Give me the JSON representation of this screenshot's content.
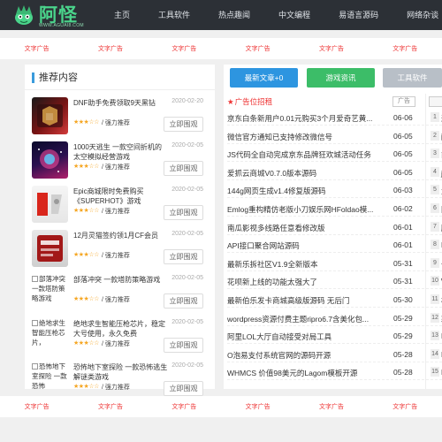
{
  "site": {
    "logo_text": "阿怪",
    "logo_url": "WWW.AGUAI8.COM",
    "nav": [
      "主页",
      "工具软件",
      "热点趣闻",
      "中文编程",
      "易语言源码",
      "网络杂谈"
    ]
  },
  "ads": {
    "top": [
      "文字广告",
      "文字广告",
      "文字广告",
      "文字广告",
      "文字广告",
      "文字广告"
    ],
    "bottom": [
      "文字广告",
      "文字广告",
      "文字广告",
      "文字广告",
      "文字广告",
      "文字广告"
    ]
  },
  "recommend": {
    "title": "推荐内容",
    "button_label": "立即围观",
    "items": [
      {
        "title": "DNF助手免费领取9天黑钻",
        "date": "2020-02-20",
        "stars": "★★★☆☆",
        "tag": "/ 强力推荐",
        "thumb": "dnf"
      },
      {
        "title": "1000天逃生 一款空间折机的太空模拟经营游戏",
        "date": "2020-02-05",
        "stars": "★★★☆☆",
        "tag": "/ 强力推荐",
        "thumb": "space"
      },
      {
        "title": "Epic商城限时免费购买《SUPERHOT》游戏",
        "date": "2020-02-05",
        "stars": "★★★☆☆",
        "tag": "/ 强力推荐",
        "thumb": "epic"
      },
      {
        "title": "12月灵猫签约领1月CF会员",
        "date": "2020-02-05",
        "stars": "★★★☆☆",
        "tag": "/ 强力推荐",
        "thumb": "cf"
      },
      {
        "title": "部落冲突 一款塔防策略游戏",
        "date": "2020-02-05",
        "stars": "★★★☆☆",
        "tag": "/ 强力推荐",
        "thumb_alt": "部落冲突 一款塔防策略游戏"
      },
      {
        "title": "绝地求生智能压枪芯片，稳定大号使用，永久免费",
        "date": "2020-02-05",
        "stars": "★★★☆☆",
        "tag": "/ 强力推荐",
        "thumb_alt": "绝地求生智能压枪芯片，"
      },
      {
        "title": "恐怖地下室探险 一款恐怖逃生解谜类游戏",
        "date": "2020-02-05",
        "stars": "★★★☆☆",
        "tag": "/ 强力推荐",
        "thumb_alt": "恐怖地下室探险 一款恐怖"
      }
    ]
  },
  "tabs": [
    "最新文章+0",
    "游戏资讯",
    "工具软件"
  ],
  "news": {
    "header": "广告位招租",
    "badge": "广告",
    "rows": [
      {
        "title": "京东白条新用户0.01元购买3个月爱奇艺黄...",
        "date": "06-06",
        "idx": "1",
        "extra": "远程"
      },
      {
        "title": "微信官方通知已支持修改微信号",
        "date": "06-05",
        "idx": "2",
        "extra": "酷我"
      },
      {
        "title": "JS代码全自动完成京东品牌狂欢城活动任务",
        "date": "06-05",
        "idx": "3",
        "extra": "简洁"
      },
      {
        "title": "爱抓云商城V0.7.0版本源码",
        "date": "06-05",
        "idx": "4",
        "extra": "js代"
      },
      {
        "title": "144g网页生成v1.4修复版源码",
        "date": "06-03",
        "idx": "5",
        "extra": "爱奇"
      },
      {
        "title": "Emlog重构精仿老版小刀娱乐网HFoldao模...",
        "date": "06-02",
        "idx": "6",
        "extra": "网络"
      },
      {
        "title": "南瓜影视多线路任意看修改版",
        "date": "06-01",
        "idx": "7",
        "extra": "腾讯"
      },
      {
        "title": "API接口聚合网站源码",
        "date": "06-01",
        "idx": "8",
        "extra": "LOL"
      },
      {
        "title": "最新乐拆社区V1.9全新版本",
        "date": "05-31",
        "idx": "9",
        "extra": "一键"
      },
      {
        "title": "花呗新上线的功能太强大了",
        "date": "05-31",
        "idx": "10",
        "extra": "Win"
      },
      {
        "title": "最新伯乐发卡商城高级版源码 无后门",
        "date": "05-30",
        "idx": "11",
        "extra": "杜仲"
      },
      {
        "title": "wordpress资源付费主题ripro6.7含美化包...",
        "date": "05-29",
        "idx": "12",
        "extra": "彩名"
      },
      {
        "title": "阿里LOL大厅自动接受对局工具",
        "date": "05-29",
        "idx": "13",
        "extra": "Lay"
      },
      {
        "title": "O泡易支付系统官网的源码开源",
        "date": "05-28",
        "idx": "14",
        "extra": "Lay"
      },
      {
        "title": "WHMCS 价值98美元的Lagom模板开源",
        "date": "05-28",
        "idx": "15",
        "extra": "Lay"
      }
    ]
  },
  "colors": {
    "topbar": "#2c3036",
    "logo": "#4ad48b",
    "tab_latest": "#2d95e0",
    "tab_game": "#3cbd68",
    "tab_tools": "#b8bfc7",
    "ad_text": "#ee3333",
    "stars": "#f5a623"
  }
}
